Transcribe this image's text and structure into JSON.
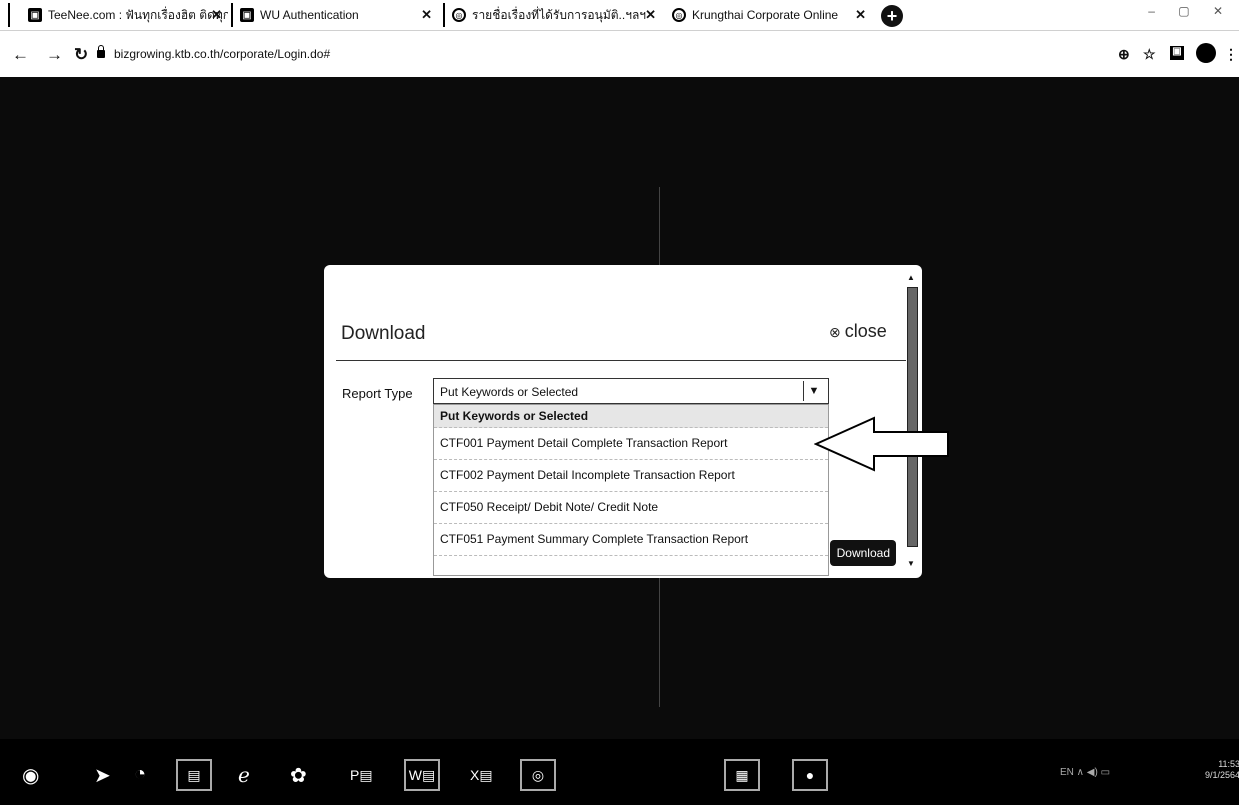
{
  "tabs": [
    {
      "title": "TeeNee.com : ฟันทุกเรื่องฮิต ติดทุก...",
      "icon": "doc-icon"
    },
    {
      "title": "WU Authentication",
      "icon": "doc-icon"
    },
    {
      "title": "รายชื่อเรื่องที่ได้รับการอนุมัติ..ฯลฯ",
      "icon": "globe-icon"
    },
    {
      "title": "Krungthai Corporate Online",
      "icon": "globe-icon"
    }
  ],
  "address": {
    "url": "bizgrowing.ktb.co.th/corporate/Login.do#"
  },
  "modal": {
    "title": "Download",
    "close_label": "close",
    "report_type_label": "Report Type",
    "selected_value": "Put Keywords or Selected",
    "options": [
      "Put Keywords or Selected",
      "CTF001 Payment Detail Complete Transaction Report",
      "CTF002 Payment Detail Incomplete Transaction Report",
      "CTF050 Receipt/ Debit Note/ Credit Note",
      "CTF051 Payment Summary Complete Transaction Report"
    ],
    "download_label": "Download"
  },
  "taskbar": {
    "items": [
      "P",
      "W",
      "X"
    ],
    "clock_time": "11:53",
    "clock_date": "9/1/2564"
  },
  "colors": {
    "page_bg": "#0b0b0b",
    "modal_bg": "#ffffff",
    "button_bg": "#111111"
  }
}
